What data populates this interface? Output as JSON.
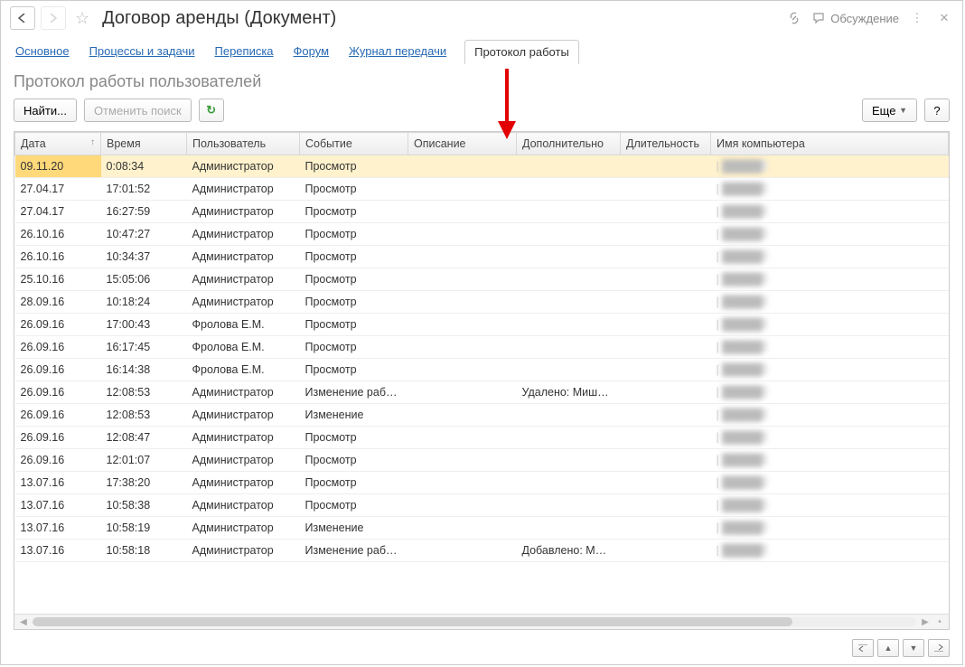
{
  "title": "Договор аренды (Документ)",
  "discuss": "Обсуждение",
  "tabs": {
    "main": "Основное",
    "proc": "Процессы и задачи",
    "corr": "Переписка",
    "forum": "Форум",
    "journal": "Журнал передачи",
    "proto": "Протокол работы"
  },
  "subtitle": "Протокол работы пользователей",
  "toolbar": {
    "find": "Найти...",
    "cancel": "Отменить поиск",
    "more": "Еще",
    "help": "?"
  },
  "cols": {
    "date": "Дата",
    "time": "Время",
    "user": "Пользователь",
    "event": "Событие",
    "desc": "Описание",
    "extra": "Дополнительно",
    "dur": "Длительность",
    "comp": "Имя компьютера"
  },
  "rows": [
    {
      "date": "09.11.20",
      "time": "0:08:34",
      "user": "Администратор",
      "event": "Просмотр",
      "desc": "",
      "extra": "",
      "dur": "",
      "sel": true
    },
    {
      "date": "27.04.17",
      "time": "17:01:52",
      "user": "Администратор",
      "event": "Просмотр",
      "desc": "",
      "extra": "",
      "dur": ""
    },
    {
      "date": "27.04.17",
      "time": "16:27:59",
      "user": "Администратор",
      "event": "Просмотр",
      "desc": "",
      "extra": "",
      "dur": ""
    },
    {
      "date": "26.10.16",
      "time": "10:47:27",
      "user": "Администратор",
      "event": "Просмотр",
      "desc": "",
      "extra": "",
      "dur": ""
    },
    {
      "date": "26.10.16",
      "time": "10:34:37",
      "user": "Администратор",
      "event": "Просмотр",
      "desc": "",
      "extra": "",
      "dur": ""
    },
    {
      "date": "25.10.16",
      "time": "15:05:06",
      "user": "Администратор",
      "event": "Просмотр",
      "desc": "",
      "extra": "",
      "dur": ""
    },
    {
      "date": "28.09.16",
      "time": "10:18:24",
      "user": "Администратор",
      "event": "Просмотр",
      "desc": "",
      "extra": "",
      "dur": ""
    },
    {
      "date": "26.09.16",
      "time": "17:00:43",
      "user": "Фролова Е.М.",
      "event": "Просмотр",
      "desc": "",
      "extra": "",
      "dur": ""
    },
    {
      "date": "26.09.16",
      "time": "16:17:45",
      "user": "Фролова Е.М.",
      "event": "Просмотр",
      "desc": "",
      "extra": "",
      "dur": ""
    },
    {
      "date": "26.09.16",
      "time": "16:14:38",
      "user": "Фролова Е.М.",
      "event": "Просмотр",
      "desc": "",
      "extra": "",
      "dur": ""
    },
    {
      "date": "26.09.16",
      "time": "12:08:53",
      "user": "Администратор",
      "event": "Изменение раб…",
      "desc": "",
      "extra": "Удалено: Миш…",
      "dur": ""
    },
    {
      "date": "26.09.16",
      "time": "12:08:53",
      "user": "Администратор",
      "event": "Изменение",
      "desc": "",
      "extra": "",
      "dur": ""
    },
    {
      "date": "26.09.16",
      "time": "12:08:47",
      "user": "Администратор",
      "event": "Просмотр",
      "desc": "",
      "extra": "",
      "dur": ""
    },
    {
      "date": "26.09.16",
      "time": "12:01:07",
      "user": "Администратор",
      "event": "Просмотр",
      "desc": "",
      "extra": "",
      "dur": ""
    },
    {
      "date": "13.07.16",
      "time": "17:38:20",
      "user": "Администратор",
      "event": "Просмотр",
      "desc": "",
      "extra": "",
      "dur": ""
    },
    {
      "date": "13.07.16",
      "time": "10:58:38",
      "user": "Администратор",
      "event": "Просмотр",
      "desc": "",
      "extra": "",
      "dur": ""
    },
    {
      "date": "13.07.16",
      "time": "10:58:19",
      "user": "Администратор",
      "event": "Изменение",
      "desc": "",
      "extra": "",
      "dur": ""
    },
    {
      "date": "13.07.16",
      "time": "10:58:18",
      "user": "Администратор",
      "event": "Изменение раб…",
      "desc": "",
      "extra": "Добавлено: М…",
      "dur": ""
    }
  ]
}
